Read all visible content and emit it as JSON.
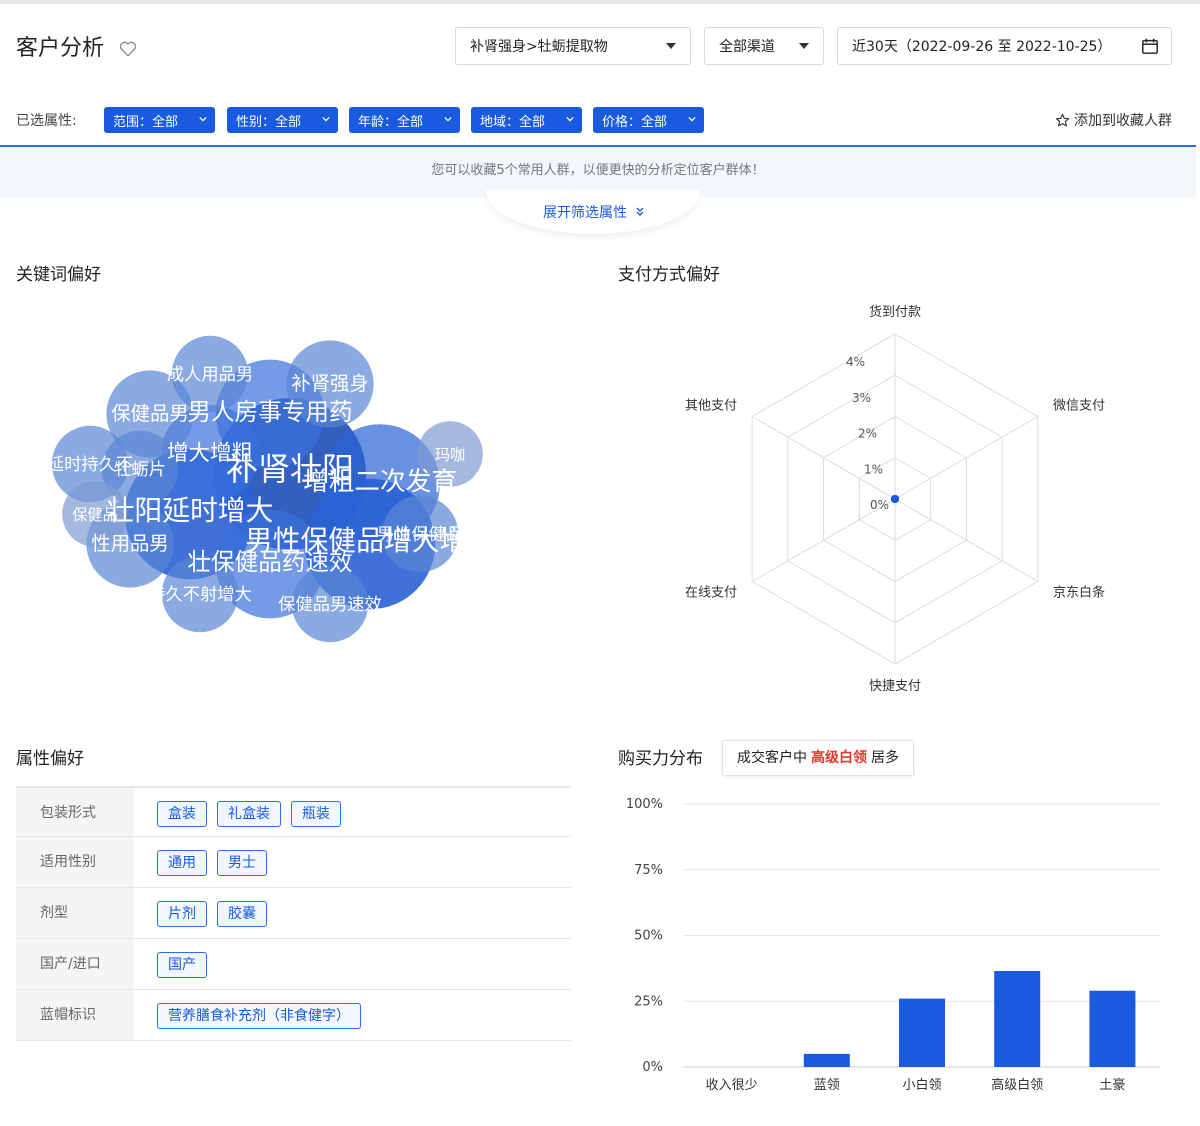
{
  "page": {
    "title": "客户分析"
  },
  "controls": {
    "category": "补肾强身>牡蛎提取物",
    "channel": "全部渠道",
    "date_range": "近30天（2022-09-26 至 2022-10-25）"
  },
  "filters": {
    "label": "已选属性:",
    "chips": [
      {
        "label": "范围：全部"
      },
      {
        "label": "性别：全部"
      },
      {
        "label": "年龄：全部"
      },
      {
        "label": "地域：全部"
      },
      {
        "label": "价格：全部"
      }
    ],
    "favorite_label": "添加到收藏人群"
  },
  "notice": "您可以收藏5个常用人群，以便更快的分析定位客户群体！",
  "expand_label": "展开筛选属性",
  "sections": {
    "keywords": "关键词偏好",
    "payment": "支付方式偏好",
    "attributes": "属性偏好",
    "purchasing": "购买力分布"
  },
  "word_cloud": {
    "words": [
      {
        "text": "补肾壮阳",
        "weight": 10
      },
      {
        "text": "男性保健品增大增粗",
        "weight": 8
      },
      {
        "text": "壮阳延时增大",
        "weight": 8
      },
      {
        "text": "增粗二次发育",
        "weight": 7
      },
      {
        "text": "男人房事专用药",
        "weight": 6
      },
      {
        "text": "壮保健品药速效",
        "weight": 6
      },
      {
        "text": "增大增粗",
        "weight": 5
      },
      {
        "text": "补肾强身",
        "weight": 4
      },
      {
        "text": "保健品男",
        "weight": 4
      },
      {
        "text": "性用品男",
        "weight": 4
      },
      {
        "text": "延时持久不",
        "weight": 3
      },
      {
        "text": "牡蛎片",
        "weight": 3
      },
      {
        "text": "成人用品男",
        "weight": 3
      },
      {
        "text": "持久不射增大",
        "weight": 3
      },
      {
        "text": "男性保健品",
        "weight": 3
      },
      {
        "text": "保健品男速效",
        "weight": 3
      },
      {
        "text": "玛咖",
        "weight": 2
      },
      {
        "text": "保健品",
        "weight": 2
      }
    ]
  },
  "radar": {
    "axes": [
      "货到付款",
      "微信支付",
      "京东白条",
      "快捷支付",
      "在线支付",
      "其他支付"
    ],
    "ticks": [
      "0%",
      "1%",
      "2%",
      "3%",
      "4%"
    ],
    "values": [
      0,
      0,
      0,
      0,
      0,
      0
    ]
  },
  "purchase_tag": {
    "prefix": "成交客户中",
    "highlight": "高级白领",
    "suffix": "居多"
  },
  "attributes": [
    {
      "name": "包装形式",
      "values": [
        "盒装",
        "礼盒装",
        "瓶装"
      ]
    },
    {
      "name": "适用性别",
      "values": [
        "通用",
        "男士"
      ]
    },
    {
      "name": "剂型",
      "values": [
        "片剂",
        "胶囊"
      ]
    },
    {
      "name": "国产/进口",
      "values": [
        "国产"
      ]
    },
    {
      "name": "蓝帽标识",
      "values": [
        "营养膳食补充剂（非食健字）"
      ]
    }
  ],
  "colors": {
    "accent": "#1a5ade",
    "highlight": "#e23a2e",
    "bar": "#1a5ade"
  },
  "chart_data": {
    "type": "bar",
    "categories": [
      "收入很少",
      "蓝领",
      "小白领",
      "高级白领",
      "土豪"
    ],
    "values": [
      0,
      5,
      26,
      36.5,
      29
    ],
    "yticks": [
      "100%",
      "75%",
      "50%",
      "25%",
      "0%"
    ],
    "ylim": [
      0,
      100
    ],
    "grid": true
  }
}
